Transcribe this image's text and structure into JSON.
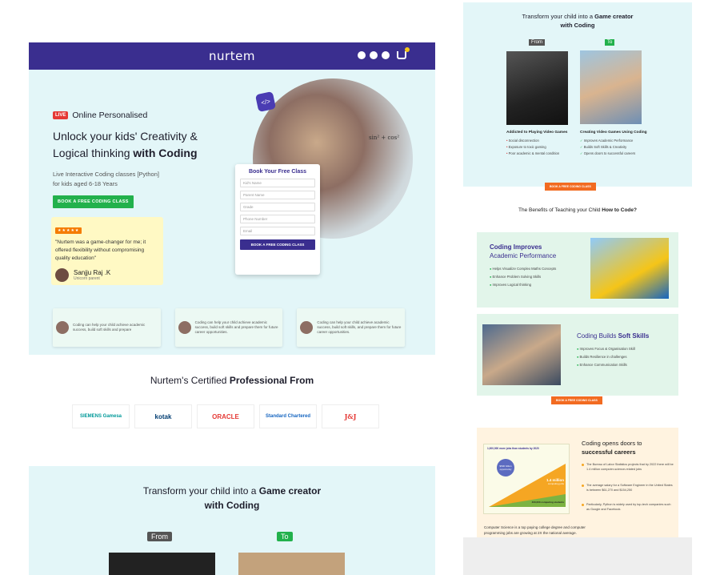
{
  "landing": {
    "logo": "nurtem",
    "live_badge": "LIVE",
    "live_label": "Online Personalised",
    "hero_title_part1": "Unlock your kids' Creativity &",
    "hero_title_part2": "Logical thinking ",
    "hero_title_bold": "with Coding",
    "hero_sub1": "Live Interactive Coding classes [Python]",
    "hero_sub2": "for kids aged 6-18 Years",
    "cta_label": "BOOK A FREE CODING CLASS",
    "review": {
      "stars": "★★★★★",
      "text": "\"Nurtem was a game-changer for me; it offered flexibility without compromising quality education\"",
      "name": "Sanjju Raj .K",
      "role": "Unicorn parent"
    },
    "form": {
      "title": "Book Your Free Class",
      "fields": [
        "Kid's Name",
        "Parent Name",
        "Grade",
        "Phone Number",
        "Email"
      ],
      "submit": "BOOK A FREE CODING CLASS"
    },
    "testimonials": [
      "Coding can help your child achieve academic success, build soft skills and prepare",
      "Coding can help your child achieve academic success, build soft skills and prepare them for future career opportunities.",
      "Coding can help your child achieve academic success, build soft skills, and prepare them for future career opportunities."
    ]
  },
  "certified": {
    "title_part": "Nurtem's Certified ",
    "title_bold": "Professional From",
    "logos": [
      "SIEMENS Gamesa",
      "kotak",
      "ORACLE",
      "Standard Chartered",
      "J&J"
    ]
  },
  "transform": {
    "title_part": "Transform your child into a ",
    "title_bold1": "Game creator",
    "title_bold2": "with Coding",
    "from": "From",
    "to": "To",
    "from_head": "Addicted to Playing Video Games",
    "to_head": "Creating Video Games Using Coding",
    "from_items": [
      "Social disconnection",
      "Exposure to toxic gaming",
      "Poor academic & mental condition"
    ],
    "to_items": [
      "Improves Academic Performance",
      "Builds Soft Skills & Creativity",
      "Opens doors to successful careers"
    ],
    "cta": "BOOK A FREE CODING CLASS"
  },
  "benefits": {
    "title_part": "The Benefits of Teaching your Child ",
    "title_bold": "How to Code?",
    "card1": {
      "head": "Coding Improves",
      "head2": "Academic Performance",
      "items": [
        "Helps Visualize Complex Maths Concepts",
        "Enhance Problem Solving Skills",
        "Improves Logical thinking"
      ]
    },
    "card2": {
      "head": "Coding Builds ",
      "head_bold": "Soft Skills",
      "items": [
        "Improves Focus & Organisation Skill",
        "Builds Resilience in challenges",
        "Enhance Communication Skills"
      ],
      "cta": "BOOK A FREE CODING CLASS"
    }
  },
  "careers": {
    "title1": "Coding opens doors to",
    "title_bold": "successful careers",
    "chart_caption": "1,000,000 more jobs than students by 2020",
    "bubble": "$500 billion opportunity",
    "label1": "1.4 million",
    "label1_sub": "computing jobs",
    "label2": "400,000 computing students",
    "items": [
      "The Bureau of Labor Statistics projects that by 2022 there will be 1.4 million computer-science-related jobs",
      "The average salary for a Software Engineer in the United States is between $61,270 and $154,250",
      "Particularly, Python is widely used by top-tech companies such as Google and Facebook."
    ],
    "bottom": "Computer Science is a top paying college degree and computer programming jobs are growing at 2X the national average."
  }
}
